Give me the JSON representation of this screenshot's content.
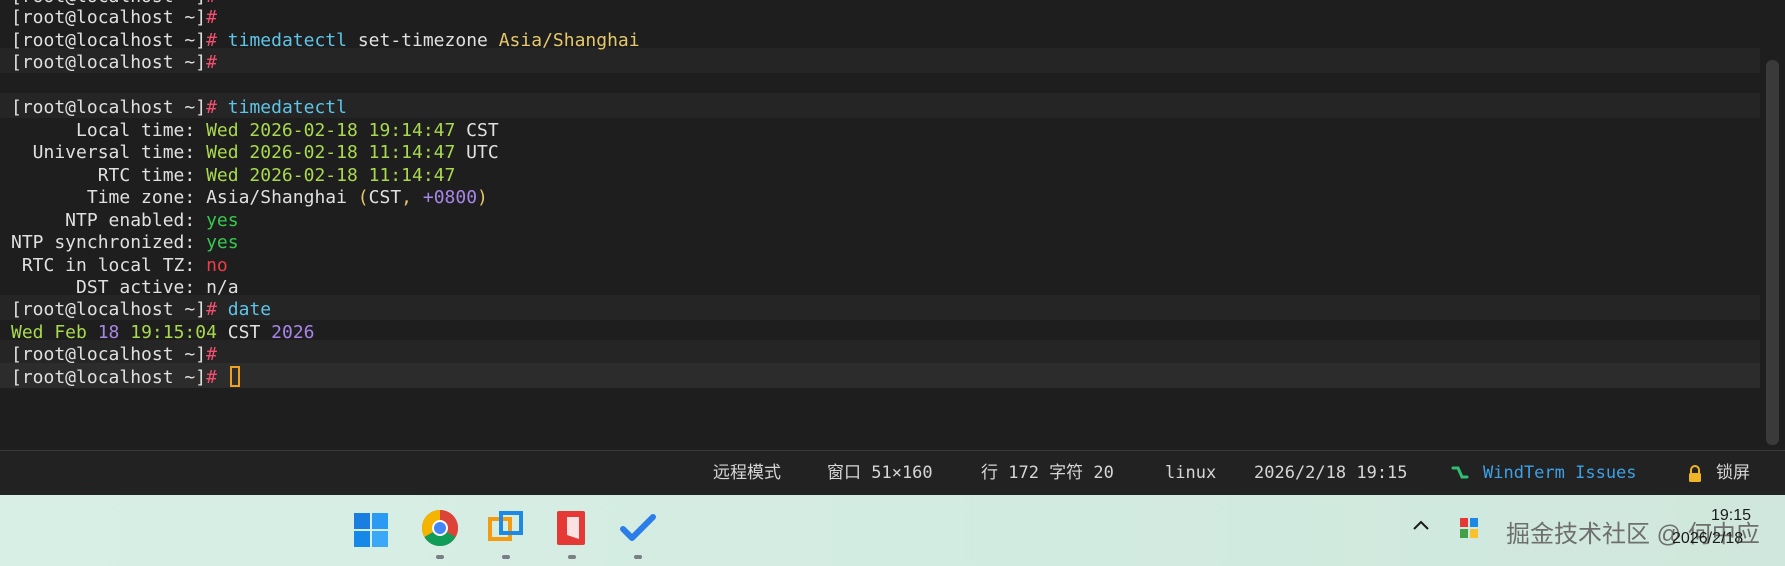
{
  "terminal": {
    "prompt": "[root@localhost ~]",
    "hash": "#",
    "cmd_set_tz": {
      "cmd": "timedatectl",
      "sub": "set-timezone",
      "arg": "Asia/Shanghai"
    },
    "cmd_td": "timedatectl",
    "td": {
      "local_label": "      Local time: ",
      "local_value": "Wed 2026-02-18 19:14:47",
      "local_tz": "CST",
      "univ_label": "  Universal time: ",
      "univ_value": "Wed 2026-02-18 11:14:47",
      "univ_tz": "UTC",
      "rtc_label": "        RTC time: ",
      "rtc_value": "Wed 2026-02-18 11:14:47",
      "zone_label": "       Time zone: ",
      "zone_name": "Asia/Shanghai",
      "zone_open": " (",
      "zone_abbr": "CST",
      "zone_sep": ", ",
      "zone_offset": "+0800",
      "zone_close": ")",
      "ntp_label": "     NTP enabled: ",
      "ntp_value": "yes",
      "sync_label": "NTP synchronized: ",
      "sync_value": "yes",
      "rtclocal_label": " RTC in local TZ: ",
      "rtclocal_value": "no",
      "dst_label": "      DST active: ",
      "dst_value": "n/a"
    },
    "cmd_date": "date",
    "date_out": {
      "wd": "Wed Feb",
      "day": "18",
      "time": "19:15:04",
      "tz": "CST",
      "year": "2026"
    }
  },
  "statusbar": {
    "mode": "远程模式",
    "window": "窗口 51×160",
    "position": "行 172 字符 20",
    "os": "linux",
    "datetime": "2026/2/18 19:15",
    "issues": "WindTerm Issues",
    "lock": "锁屏"
  },
  "taskbar": {
    "time": "19:15",
    "date": "2026/2/18",
    "watermark": "掘金技术社区 @ 何中应"
  },
  "colors": {
    "prompt_hash": "#f0506e",
    "command": "#5ec4e8",
    "argument": "#e6c86a",
    "datetime": "#a8d94e",
    "number": "#a985e8",
    "yes": "#35c94f",
    "no": "#ee3d4a"
  }
}
